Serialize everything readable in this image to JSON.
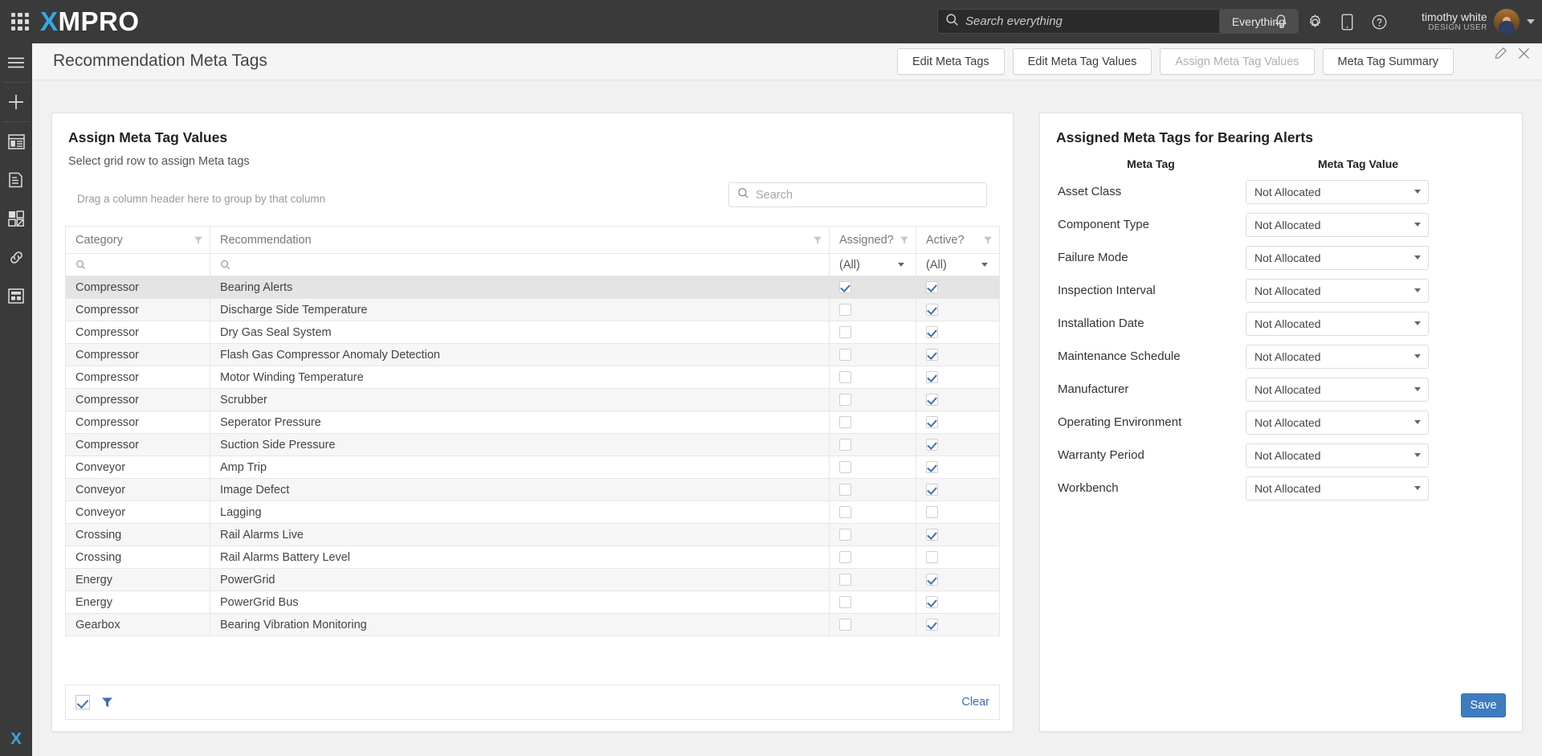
{
  "topbar": {
    "brand_x": "X",
    "brand_rest": "MPRO",
    "search_placeholder": "Search everything",
    "search_value": "",
    "scope_button": "Everything",
    "icons": [
      "bell-icon",
      "gear-icon",
      "mobile-icon",
      "help-icon"
    ],
    "user_name": "timothy white",
    "user_role": "DESIGN USER"
  },
  "rail": {
    "items": [
      {
        "name": "menu-icon"
      },
      {
        "name": "add-icon"
      },
      {
        "name": "dashboard-icon"
      },
      {
        "name": "report-icon"
      },
      {
        "name": "blocks-icon"
      },
      {
        "name": "link-icon"
      },
      {
        "name": "form-icon"
      }
    ],
    "logo": {
      "a": "X",
      "b": ""
    }
  },
  "page": {
    "title": "Recommendation Meta Tags",
    "tabs": [
      {
        "label": "Edit Meta Tags",
        "state": "normal"
      },
      {
        "label": "Edit Meta Tag Values",
        "state": "normal"
      },
      {
        "label": "Assign Meta Tag Values",
        "state": "disabled"
      },
      {
        "label": "Meta Tag Summary",
        "state": "normal"
      }
    ],
    "tools": [
      "pencil-icon",
      "close-icon"
    ]
  },
  "left_panel": {
    "title": "Assign Meta Tag Values",
    "subtitle": "Select grid row to assign Meta tags",
    "drag_hint": "Drag a column header here to group by that column",
    "search_placeholder": "Search",
    "search_value": "",
    "columns": [
      {
        "label": "Category"
      },
      {
        "label": "Recommendation"
      },
      {
        "label": "Assigned?"
      },
      {
        "label": "Active?"
      }
    ],
    "filter_row": {
      "category": "",
      "recommendation": "",
      "assigned": "(All)",
      "active": "(All)"
    },
    "rows": [
      {
        "category": "Compressor",
        "recommendation": "Bearing Alerts",
        "assigned": true,
        "active": true,
        "selected": true
      },
      {
        "category": "Compressor",
        "recommendation": "Discharge Side Temperature",
        "assigned": false,
        "active": true,
        "selected": false
      },
      {
        "category": "Compressor",
        "recommendation": "Dry Gas Seal System",
        "assigned": false,
        "active": true,
        "selected": false
      },
      {
        "category": "Compressor",
        "recommendation": "Flash Gas Compressor Anomaly Detection",
        "assigned": false,
        "active": true,
        "selected": false
      },
      {
        "category": "Compressor",
        "recommendation": "Motor Winding Temperature",
        "assigned": false,
        "active": true,
        "selected": false
      },
      {
        "category": "Compressor",
        "recommendation": "Scrubber",
        "assigned": false,
        "active": true,
        "selected": false
      },
      {
        "category": "Compressor",
        "recommendation": "Seperator Pressure",
        "assigned": false,
        "active": true,
        "selected": false
      },
      {
        "category": "Compressor",
        "recommendation": "Suction Side Pressure",
        "assigned": false,
        "active": true,
        "selected": false
      },
      {
        "category": "Conveyor",
        "recommendation": "Amp Trip",
        "assigned": false,
        "active": true,
        "selected": false
      },
      {
        "category": "Conveyor",
        "recommendation": "Image Defect",
        "assigned": false,
        "active": true,
        "selected": false
      },
      {
        "category": "Conveyor",
        "recommendation": "Lagging",
        "assigned": false,
        "active": false,
        "selected": false
      },
      {
        "category": "Crossing",
        "recommendation": "Rail Alarms Live",
        "assigned": false,
        "active": true,
        "selected": false
      },
      {
        "category": "Crossing",
        "recommendation": "Rail Alarms Battery Level",
        "assigned": false,
        "active": false,
        "selected": false
      },
      {
        "category": "Energy",
        "recommendation": "PowerGrid",
        "assigned": false,
        "active": true,
        "selected": false
      },
      {
        "category": "Energy",
        "recommendation": "PowerGrid Bus",
        "assigned": false,
        "active": true,
        "selected": false
      },
      {
        "category": "Gearbox",
        "recommendation": "Bearing Vibration Monitoring",
        "assigned": false,
        "active": true,
        "selected": false
      }
    ],
    "footer": {
      "filter_enabled_checkbox": true,
      "funnel_icon": "filter-icon",
      "clear_label": "Clear"
    }
  },
  "right_panel": {
    "title": "Assigned Meta Tags for Bearing Alerts",
    "col_tag": "Meta Tag",
    "col_value": "Meta Tag Value",
    "rows": [
      {
        "tag": "Asset Class",
        "value": "Not Allocated"
      },
      {
        "tag": "Component Type",
        "value": "Not Allocated"
      },
      {
        "tag": "Failure Mode",
        "value": "Not Allocated"
      },
      {
        "tag": "Inspection Interval",
        "value": "Not Allocated"
      },
      {
        "tag": "Installation Date",
        "value": "Not Allocated"
      },
      {
        "tag": "Maintenance Schedule",
        "value": "Not Allocated"
      },
      {
        "tag": "Manufacturer",
        "value": "Not Allocated"
      },
      {
        "tag": "Operating Environment",
        "value": "Not Allocated"
      },
      {
        "tag": "Warranty Period",
        "value": "Not Allocated"
      },
      {
        "tag": "Workbench",
        "value": "Not Allocated"
      }
    ],
    "save_label": "Save"
  },
  "colors": {
    "brand_blue": "#36a9e1",
    "accent_blue": "#3d6fb4",
    "chrome_dark": "#3a3a3a",
    "page_bg": "#f1f1f1"
  }
}
